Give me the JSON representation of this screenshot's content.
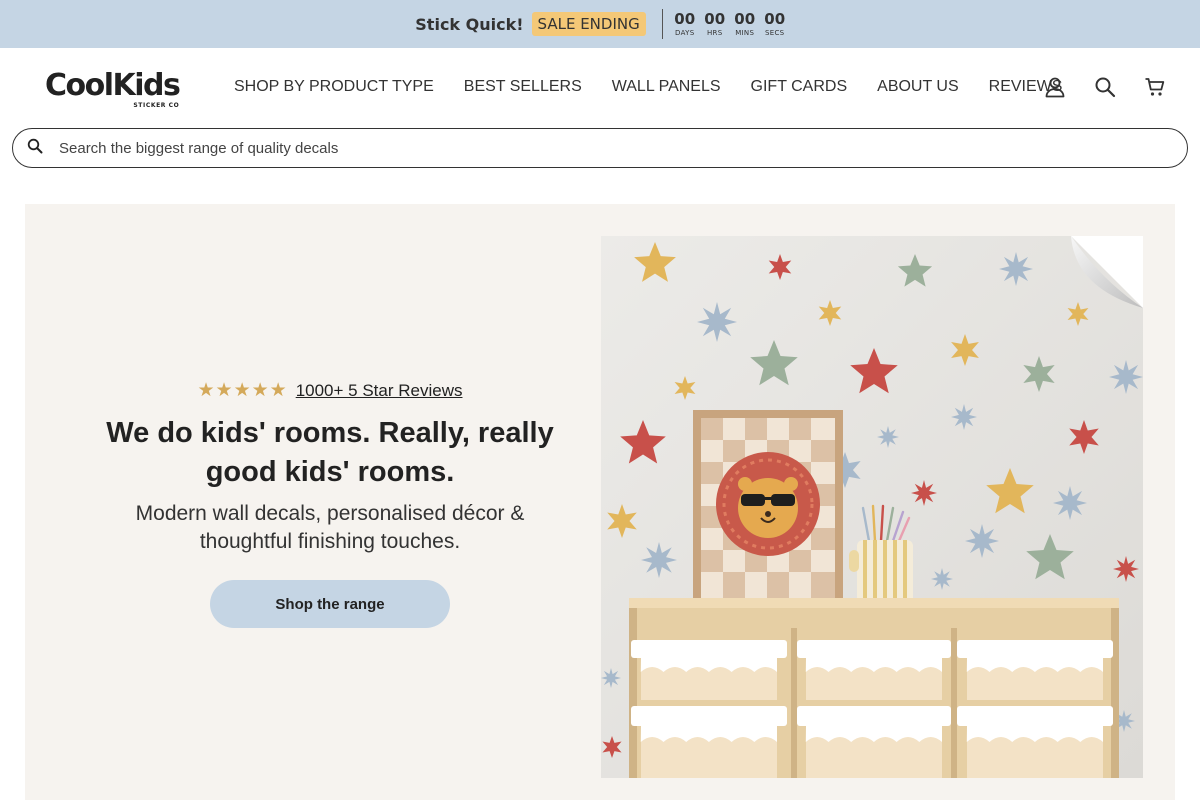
{
  "announcement": {
    "text": "Stick Quick!",
    "badge": "SALE ENDING",
    "countdown": [
      {
        "value": "00",
        "label": "DAYS"
      },
      {
        "value": "00",
        "label": "HRS"
      },
      {
        "value": "00",
        "label": "MINS"
      },
      {
        "value": "00",
        "label": "SECS"
      }
    ],
    "bar_color": "#c5d5e4",
    "badge_color": "#f4c877"
  },
  "header": {
    "logo": {
      "main": "CoolKids",
      "sub": "STICKER CO"
    },
    "nav": [
      {
        "label": "SHOP BY PRODUCT TYPE"
      },
      {
        "label": "BEST SELLERS"
      },
      {
        "label": "WALL PANELS"
      },
      {
        "label": "GIFT CARDS"
      },
      {
        "label": "ABOUT US"
      },
      {
        "label": "REVIEWS"
      }
    ],
    "icons": [
      "account-icon",
      "search-icon",
      "cart-icon"
    ]
  },
  "search": {
    "placeholder": "Search the biggest range of quality decals",
    "value": ""
  },
  "hero": {
    "stars": "★★★★★",
    "reviews_link": "1000+ 5 Star Reviews",
    "title": "We do kids' rooms. Really, really good kids' rooms.",
    "subtitle": "Modern wall decals, personalised décor & thoughtful finishing touches.",
    "cta": "Shop the range",
    "background": "#f6f3ef",
    "cta_color": "#c5d5e4"
  }
}
